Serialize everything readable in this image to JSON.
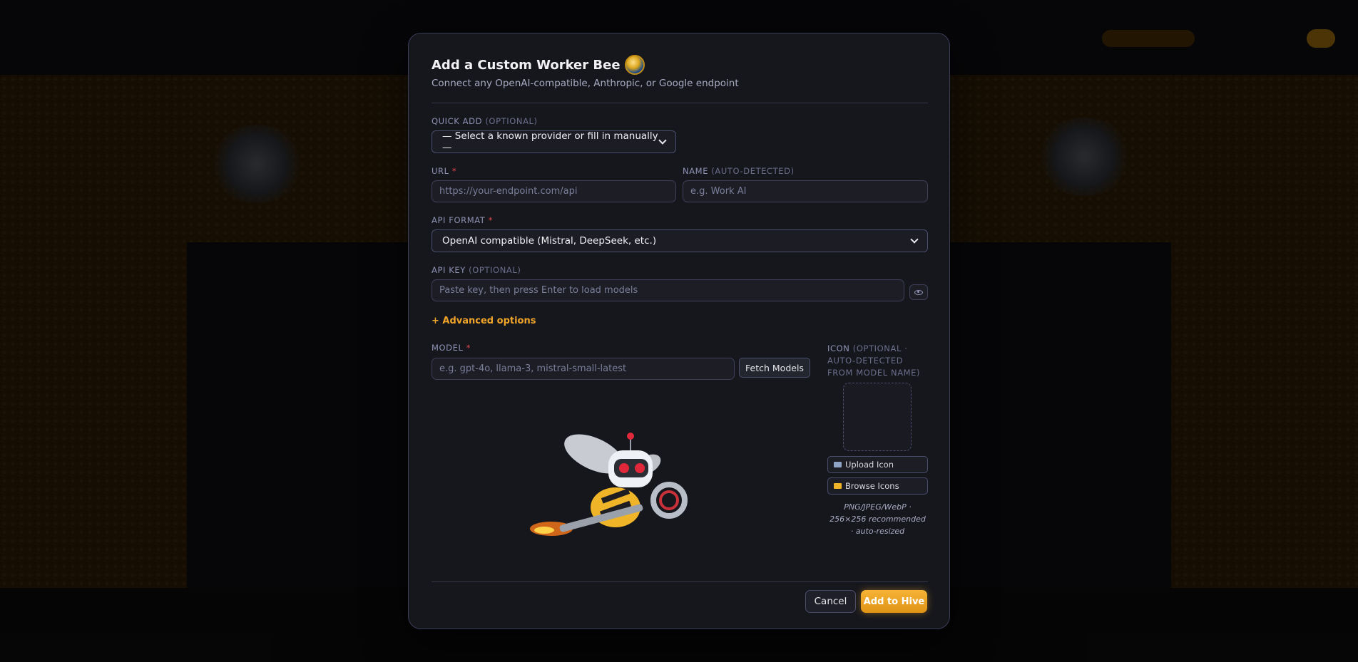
{
  "modal": {
    "title": "Add a Custom Worker Bee",
    "subtitle": "Connect any OpenAI-compatible, Anthropic, or Google endpoint"
  },
  "quick_add": {
    "label": "QUICK ADD",
    "optional": "(OPTIONAL)",
    "selected": "— Select a known provider or fill in manually —"
  },
  "url": {
    "label": "URL",
    "required": "*",
    "placeholder": "https://your-endpoint.com/api"
  },
  "name": {
    "label": "NAME",
    "optional": "(AUTO-DETECTED)",
    "placeholder": "e.g. Work AI"
  },
  "api_format": {
    "label": "API FORMAT",
    "required": "*",
    "selected": "OpenAI compatible (Mistral, DeepSeek, etc.)"
  },
  "api_key": {
    "label": "API KEY",
    "optional": "(OPTIONAL)",
    "placeholder": "Paste key, then press Enter to load models"
  },
  "advanced": {
    "label": "+ Advanced options"
  },
  "model": {
    "label": "MODEL",
    "required": "*",
    "placeholder": "e.g. gpt-4o, llama-3, mistral-small-latest",
    "fetch_label": "Fetch Models"
  },
  "icon": {
    "label": "ICON",
    "optional": "(OPTIONAL · AUTO-DETECTED FROM MODEL NAME)",
    "upload_label": "Upload Icon",
    "browse_label": "Browse Icons",
    "note": "PNG/JPEG/WebP · 256×256 recommended · auto-resized"
  },
  "footer": {
    "cancel_label": "Cancel",
    "submit_label": "Add to Hive"
  },
  "colors": {
    "accent": "#f0a429",
    "required": "#e0494a",
    "modal_bg": "#16171d",
    "border": "#3a3d55"
  }
}
